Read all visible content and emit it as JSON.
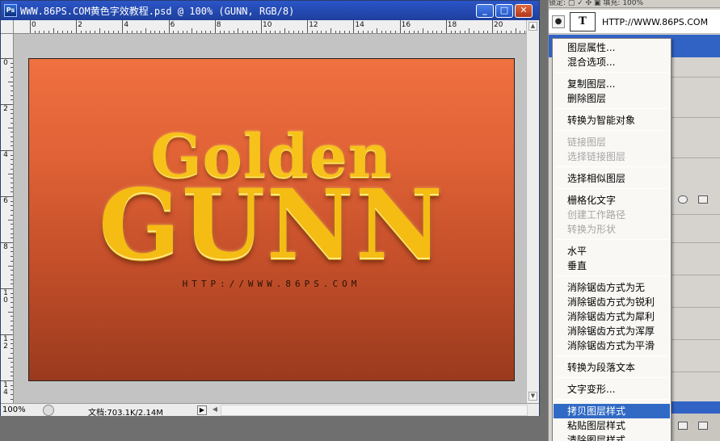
{
  "document": {
    "title": "WWW.86PS.COM黄色字效教程.psd @ 100% (GUNN, RGB/8)",
    "app_icon_label": "Ps",
    "window_buttons": {
      "minimize": "_",
      "maximize": "□",
      "close": "✕"
    },
    "ruler_h": [
      "0",
      "2",
      "4",
      "6",
      "8",
      "10",
      "12",
      "14",
      "16",
      "18",
      "20"
    ],
    "ruler_v": [
      {
        "a": "0",
        "b": ""
      },
      {
        "a": "2",
        "b": ""
      },
      {
        "a": "4",
        "b": ""
      },
      {
        "a": "6",
        "b": ""
      },
      {
        "a": "8",
        "b": ""
      },
      {
        "a": "1",
        "b": "0"
      },
      {
        "a": "1",
        "b": "2"
      },
      {
        "a": "1",
        "b": "4"
      }
    ],
    "artwork": {
      "line1": "Golden",
      "line2": "GUNN",
      "url": "HTTP://WWW.86PS.COM"
    },
    "status": {
      "zoom": "100%",
      "doc_info": "文档:703.1K/2.14M",
      "arrow": "▶",
      "scroll_left": "◀"
    }
  },
  "layers_panel": {
    "top_strip": "锁定: ▢ ✓ ✣ ▣    填充: 100%",
    "layer1": {
      "eye": "●",
      "thumb": "T",
      "name": "HTTP://WWW.86PS.COM"
    }
  },
  "context_menu": {
    "groups": [
      [
        "图层属性...",
        "混合选项..."
      ],
      [
        "复制图层...",
        "删除图层"
      ],
      [
        "转换为智能对象"
      ],
      [
        "链接图层",
        "选择链接图层"
      ],
      [
        "选择相似图层"
      ],
      [
        "栅格化文字",
        "创建工作路径",
        "转换为形状"
      ],
      [
        "水平",
        "垂直"
      ],
      [
        "消除锯齿方式为无",
        "消除锯齿方式为锐利",
        "消除锯齿方式为犀利",
        "消除锯齿方式为浑厚",
        "消除锯齿方式为平滑"
      ],
      [
        "转换为段落文本"
      ],
      [
        "文字变形..."
      ],
      [
        "拷贝图层样式",
        "粘贴图层样式",
        "清除图层样式"
      ]
    ],
    "disabled": [
      "链接图层",
      "选择链接图层",
      "创建工作路径",
      "转换为形状"
    ],
    "selected": "拷贝图层样式"
  },
  "colors": {
    "titlebar": "#1e3f9c",
    "canvas_top": "#f07040",
    "canvas_bottom": "#9a3a1e",
    "gold": "#f5bc14",
    "menu_highlight": "#316ac5"
  }
}
